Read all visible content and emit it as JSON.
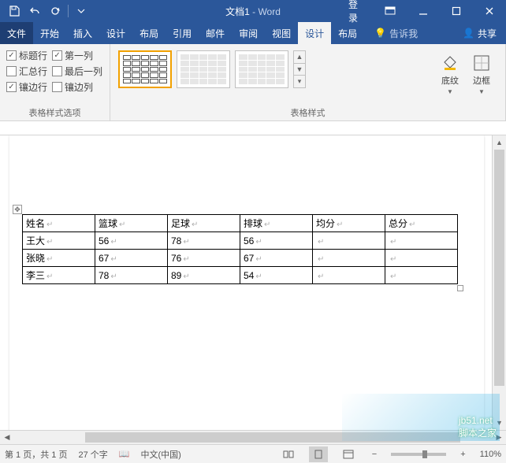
{
  "titlebar": {
    "doc_name": "文档1",
    "app_suffix": " - Word",
    "login": "登录"
  },
  "menu": {
    "file": "文件",
    "start": "开始",
    "insert": "插入",
    "design1": "设计",
    "layout1": "布局",
    "ref": "引用",
    "mail": "邮件",
    "review": "审阅",
    "view": "视图",
    "design_active": "设计",
    "layout2": "布局",
    "tell_me": "告诉我",
    "share": "共享"
  },
  "ribbon": {
    "options_group": "表格样式选项",
    "styles_group": "表格样式",
    "shading": "底纹",
    "borders": "边框",
    "cb": {
      "header_row": "标题行",
      "first_col": "第一列",
      "total_row": "汇总行",
      "last_col": "最后一列",
      "banded_row": "镶边行",
      "banded_col": "镶边列"
    },
    "cb_state": {
      "header_row": true,
      "first_col": true,
      "total_row": false,
      "last_col": false,
      "banded_row": true,
      "banded_col": false
    }
  },
  "table": {
    "headers": [
      "姓名",
      "篮球",
      "足球",
      "排球",
      "均分",
      "总分"
    ],
    "rows": [
      {
        "name": "王大",
        "c1": "56",
        "c2": "78",
        "c3": "56",
        "c4": "",
        "c5": ""
      },
      {
        "name": "张晓",
        "c1": "67",
        "c2": "76",
        "c3": "67",
        "c4": "",
        "c5": ""
      },
      {
        "name": "李三",
        "c1": "78",
        "c2": "89",
        "c3": "54",
        "c4": "",
        "c5": ""
      }
    ]
  },
  "status": {
    "page": "第 1 页，共 1 页",
    "words": "27 个字",
    "lang": "中文(中国)",
    "zoom": "110%"
  },
  "watermark": {
    "a": "jb51.net",
    "b": "脚本之家"
  }
}
